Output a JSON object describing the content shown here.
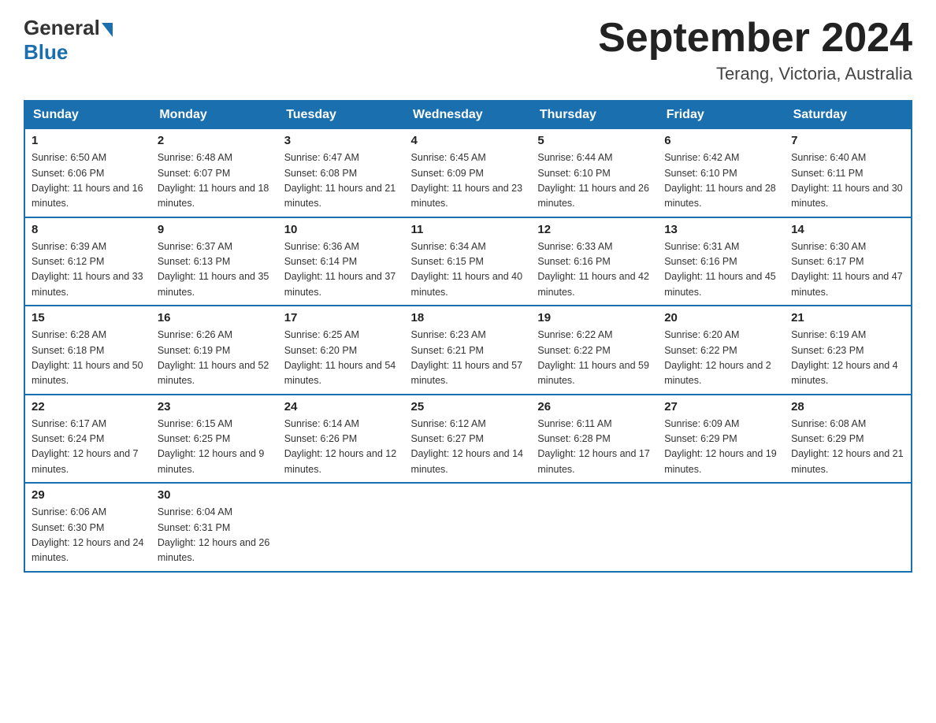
{
  "header": {
    "logo": {
      "general": "General",
      "blue": "Blue"
    },
    "title": "September 2024",
    "location": "Terang, Victoria, Australia"
  },
  "calendar": {
    "days_of_week": [
      "Sunday",
      "Monday",
      "Tuesday",
      "Wednesday",
      "Thursday",
      "Friday",
      "Saturday"
    ],
    "weeks": [
      [
        {
          "day": "1",
          "sunrise": "6:50 AM",
          "sunset": "6:06 PM",
          "daylight": "11 hours and 16 minutes."
        },
        {
          "day": "2",
          "sunrise": "6:48 AM",
          "sunset": "6:07 PM",
          "daylight": "11 hours and 18 minutes."
        },
        {
          "day": "3",
          "sunrise": "6:47 AM",
          "sunset": "6:08 PM",
          "daylight": "11 hours and 21 minutes."
        },
        {
          "day": "4",
          "sunrise": "6:45 AM",
          "sunset": "6:09 PM",
          "daylight": "11 hours and 23 minutes."
        },
        {
          "day": "5",
          "sunrise": "6:44 AM",
          "sunset": "6:10 PM",
          "daylight": "11 hours and 26 minutes."
        },
        {
          "day": "6",
          "sunrise": "6:42 AM",
          "sunset": "6:10 PM",
          "daylight": "11 hours and 28 minutes."
        },
        {
          "day": "7",
          "sunrise": "6:40 AM",
          "sunset": "6:11 PM",
          "daylight": "11 hours and 30 minutes."
        }
      ],
      [
        {
          "day": "8",
          "sunrise": "6:39 AM",
          "sunset": "6:12 PM",
          "daylight": "11 hours and 33 minutes."
        },
        {
          "day": "9",
          "sunrise": "6:37 AM",
          "sunset": "6:13 PM",
          "daylight": "11 hours and 35 minutes."
        },
        {
          "day": "10",
          "sunrise": "6:36 AM",
          "sunset": "6:14 PM",
          "daylight": "11 hours and 37 minutes."
        },
        {
          "day": "11",
          "sunrise": "6:34 AM",
          "sunset": "6:15 PM",
          "daylight": "11 hours and 40 minutes."
        },
        {
          "day": "12",
          "sunrise": "6:33 AM",
          "sunset": "6:16 PM",
          "daylight": "11 hours and 42 minutes."
        },
        {
          "day": "13",
          "sunrise": "6:31 AM",
          "sunset": "6:16 PM",
          "daylight": "11 hours and 45 minutes."
        },
        {
          "day": "14",
          "sunrise": "6:30 AM",
          "sunset": "6:17 PM",
          "daylight": "11 hours and 47 minutes."
        }
      ],
      [
        {
          "day": "15",
          "sunrise": "6:28 AM",
          "sunset": "6:18 PM",
          "daylight": "11 hours and 50 minutes."
        },
        {
          "day": "16",
          "sunrise": "6:26 AM",
          "sunset": "6:19 PM",
          "daylight": "11 hours and 52 minutes."
        },
        {
          "day": "17",
          "sunrise": "6:25 AM",
          "sunset": "6:20 PM",
          "daylight": "11 hours and 54 minutes."
        },
        {
          "day": "18",
          "sunrise": "6:23 AM",
          "sunset": "6:21 PM",
          "daylight": "11 hours and 57 minutes."
        },
        {
          "day": "19",
          "sunrise": "6:22 AM",
          "sunset": "6:22 PM",
          "daylight": "11 hours and 59 minutes."
        },
        {
          "day": "20",
          "sunrise": "6:20 AM",
          "sunset": "6:22 PM",
          "daylight": "12 hours and 2 minutes."
        },
        {
          "day": "21",
          "sunrise": "6:19 AM",
          "sunset": "6:23 PM",
          "daylight": "12 hours and 4 minutes."
        }
      ],
      [
        {
          "day": "22",
          "sunrise": "6:17 AM",
          "sunset": "6:24 PM",
          "daylight": "12 hours and 7 minutes."
        },
        {
          "day": "23",
          "sunrise": "6:15 AM",
          "sunset": "6:25 PM",
          "daylight": "12 hours and 9 minutes."
        },
        {
          "day": "24",
          "sunrise": "6:14 AM",
          "sunset": "6:26 PM",
          "daylight": "12 hours and 12 minutes."
        },
        {
          "day": "25",
          "sunrise": "6:12 AM",
          "sunset": "6:27 PM",
          "daylight": "12 hours and 14 minutes."
        },
        {
          "day": "26",
          "sunrise": "6:11 AM",
          "sunset": "6:28 PM",
          "daylight": "12 hours and 17 minutes."
        },
        {
          "day": "27",
          "sunrise": "6:09 AM",
          "sunset": "6:29 PM",
          "daylight": "12 hours and 19 minutes."
        },
        {
          "day": "28",
          "sunrise": "6:08 AM",
          "sunset": "6:29 PM",
          "daylight": "12 hours and 21 minutes."
        }
      ],
      [
        {
          "day": "29",
          "sunrise": "6:06 AM",
          "sunset": "6:30 PM",
          "daylight": "12 hours and 24 minutes."
        },
        {
          "day": "30",
          "sunrise": "6:04 AM",
          "sunset": "6:31 PM",
          "daylight": "12 hours and 26 minutes."
        },
        null,
        null,
        null,
        null,
        null
      ]
    ],
    "labels": {
      "sunrise": "Sunrise:",
      "sunset": "Sunset:",
      "daylight": "Daylight:"
    }
  }
}
